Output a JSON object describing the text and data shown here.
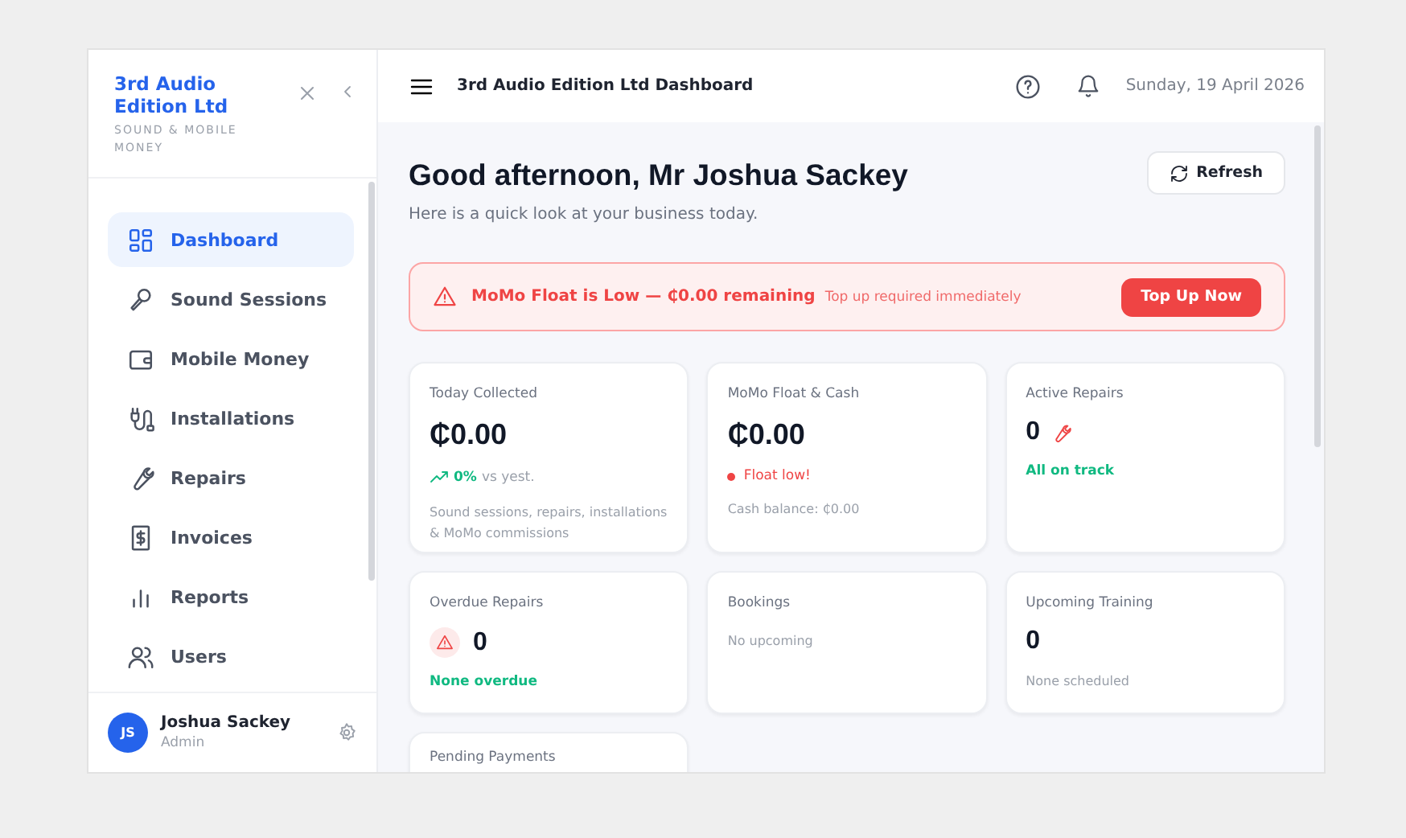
{
  "sidebar": {
    "brand": "3rd Audio Edition Ltd",
    "tagline": "SOUND & MOBILE MONEY",
    "items": [
      {
        "label": "Dashboard",
        "selected": true
      },
      {
        "label": "Sound Sessions",
        "selected": false
      },
      {
        "label": "Mobile Money",
        "selected": false
      },
      {
        "label": "Installations",
        "selected": false
      },
      {
        "label": "Repairs",
        "selected": false
      },
      {
        "label": "Invoices",
        "selected": false
      },
      {
        "label": "Reports",
        "selected": false
      },
      {
        "label": "Users",
        "selected": false
      }
    ],
    "user": {
      "initials": "JS",
      "name": "Joshua Sackey",
      "role": "Admin"
    }
  },
  "topbar": {
    "title": "3rd Audio Edition Ltd Dashboard",
    "date": "Sunday, 19 April 2026"
  },
  "greeting": {
    "title": "Good afternoon, Mr Joshua Sackey",
    "subtitle": "Here is a quick look at your business today.",
    "refresh": "Refresh"
  },
  "alert": {
    "title": "MoMo Float is Low — ₵0.00 remaining",
    "detail": "Top up required immediately",
    "action": "Top Up Now"
  },
  "cards": [
    {
      "kind": "money",
      "label": "Today Collected",
      "value": "₵0.00",
      "trend": "0%",
      "trend_text": "vs yest.",
      "note": "Sound sessions, repairs, installations & MoMo commissions"
    },
    {
      "kind": "money",
      "label": "MoMo Float & Cash",
      "value": "₵0.00",
      "status": {
        "kind": "danger",
        "text": "Float low!"
      },
      "note": "Cash balance: ₵0.00"
    },
    {
      "kind": "count",
      "label": "Active Repairs",
      "value": "0",
      "value_icon": {
        "kind": "wrench"
      },
      "status": {
        "kind": "success",
        "text": "All on track"
      }
    },
    {
      "kind": "count",
      "label": "Overdue Repairs",
      "value": "0",
      "value_icon": {
        "kind": "warning"
      },
      "status": {
        "kind": "success",
        "text": "None overdue"
      }
    },
    {
      "kind": "empty",
      "label": "Bookings",
      "note": "No upcoming"
    },
    {
      "kind": "count",
      "label": "Upcoming Training",
      "value": "0",
      "note": "None scheduled"
    },
    {
      "kind": "partial",
      "label": "Pending Payments"
    }
  ]
}
